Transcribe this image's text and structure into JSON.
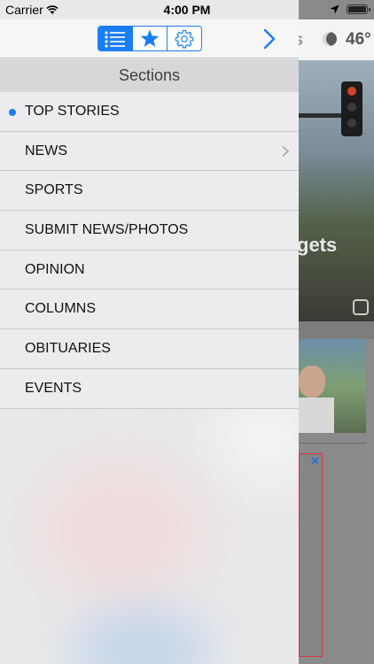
{
  "status_bar": {
    "carrier": "Carrier",
    "time": "4:00 PM"
  },
  "drawer": {
    "tabs": [
      {
        "name": "sections",
        "icon": "list-icon",
        "active": true
      },
      {
        "name": "favorites",
        "icon": "star-icon",
        "active": false
      },
      {
        "name": "settings",
        "icon": "gear-icon",
        "active": false
      }
    ],
    "forward_icon": "chevron-right-icon",
    "sections_title": "Sections",
    "sections": [
      {
        "label": "TOP STORIES",
        "selected": true,
        "has_children": false
      },
      {
        "label": "NEWS",
        "selected": false,
        "has_children": true
      },
      {
        "label": "SPORTS",
        "selected": false,
        "has_children": false
      },
      {
        "label": "SUBMIT NEWS/PHOTOS",
        "selected": false,
        "has_children": false
      },
      {
        "label": "OPINION",
        "selected": false,
        "has_children": false
      },
      {
        "label": "COLUMNS",
        "selected": false,
        "has_children": false
      },
      {
        "label": "OBITUARIES",
        "selected": false,
        "has_children": false
      },
      {
        "label": "EVENTS",
        "selected": false,
        "has_children": false
      }
    ]
  },
  "background": {
    "header_partial": "s",
    "weather_temp": "46°",
    "weather_icon": "moon-icon",
    "photo_text": "gets"
  },
  "colors": {
    "accent": "#1a7ef5",
    "drawer_bg": "#e9e9ea",
    "section_header_bg": "#d7d7d9"
  }
}
